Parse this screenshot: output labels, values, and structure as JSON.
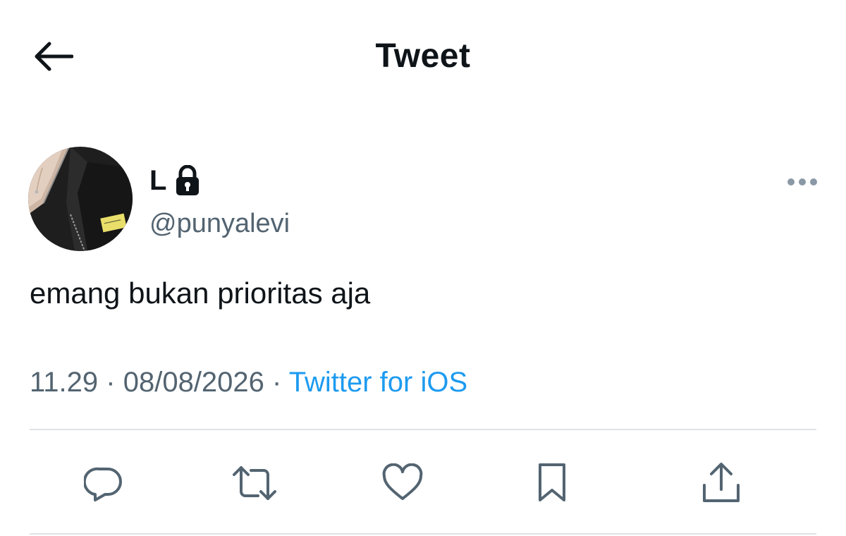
{
  "header": {
    "title": "Tweet",
    "back_icon": "arrow-left-icon"
  },
  "tweet": {
    "author": {
      "display_name": "L",
      "handle": "@punyalevi",
      "protected_icon": "lock-icon",
      "avatar_icon": "avatar-photo"
    },
    "more_icon": "more-dots-icon",
    "text": "emang bukan prioritas aja",
    "time": "11.29",
    "separator": "·",
    "date": "08/08/2026",
    "source": "Twitter for iOS"
  },
  "actions": [
    {
      "icon": "reply-icon"
    },
    {
      "icon": "retweet-icon"
    },
    {
      "icon": "like-icon"
    },
    {
      "icon": "bookmark-icon"
    },
    {
      "icon": "share-icon"
    }
  ],
  "colors": {
    "text": "#0f1419",
    "secondary": "#536471",
    "link": "#1d9bf0",
    "divider": "#dde3e8"
  }
}
